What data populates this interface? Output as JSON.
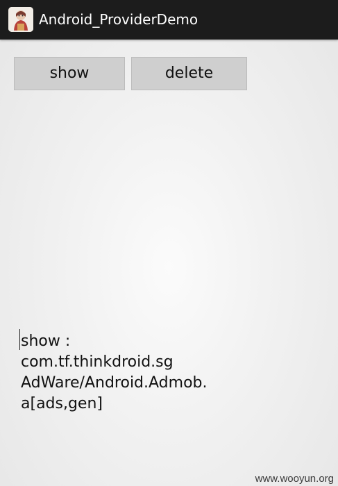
{
  "actionbar": {
    "title": "Android_ProviderDemo",
    "icon": "app-launcher-icon"
  },
  "buttons": {
    "show_label": "show",
    "delete_label": "delete"
  },
  "output": {
    "lines": [
      "show :",
      "com.tf.thinkdroid.sg",
      "AdWare/Android.Admob.",
      "a[ads,gen]"
    ]
  },
  "watermark": "www.wooyun.org",
  "colors": {
    "actionbar_bg": "#1c1c1c",
    "button_bg": "#cfcfcf",
    "text": "#111111"
  }
}
